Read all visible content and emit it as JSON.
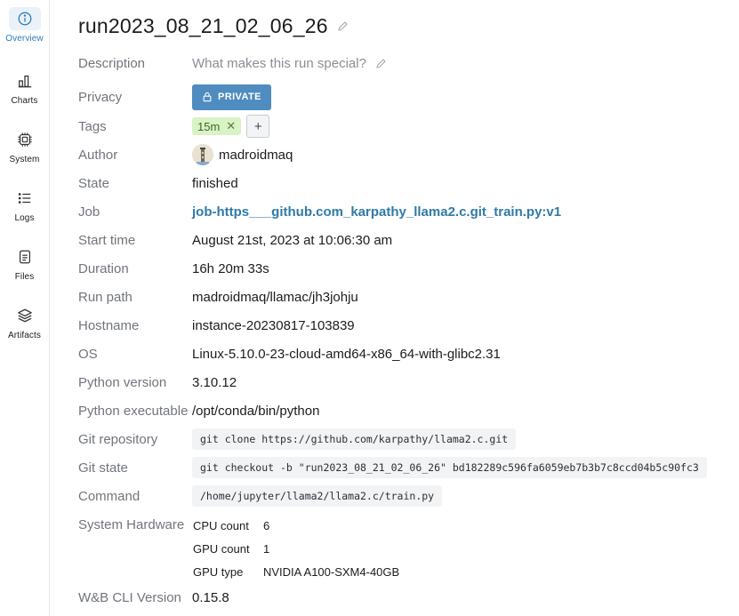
{
  "sidebar": {
    "items": [
      {
        "label": "Overview",
        "icon": "info-icon"
      },
      {
        "label": "Charts",
        "icon": "bar-chart-icon"
      },
      {
        "label": "System",
        "icon": "cpu-icon"
      },
      {
        "label": "Logs",
        "icon": "list-icon"
      },
      {
        "label": "Files",
        "icon": "file-icon"
      },
      {
        "label": "Artifacts",
        "icon": "layers-icon"
      }
    ],
    "active": "Overview",
    "active_color": "#2b7bb9"
  },
  "run": {
    "title": "run2023_08_21_02_06_26",
    "rows": {
      "description": {
        "label": "Description",
        "placeholder": "What makes this run special?"
      },
      "privacy": {
        "label": "Privacy",
        "value": "PRIVATE"
      },
      "tags": {
        "label": "Tags",
        "items": [
          "15m"
        ],
        "add": "+"
      },
      "author": {
        "label": "Author",
        "value": "madroidmaq"
      },
      "state": {
        "label": "State",
        "value": "finished"
      },
      "job": {
        "label": "Job",
        "value": "job-https___github.com_karpathy_llama2.c.git_train.py:v1"
      },
      "start_time": {
        "label": "Start time",
        "value": "August 21st, 2023 at 10:06:30 am"
      },
      "duration": {
        "label": "Duration",
        "value": "16h 20m 33s"
      },
      "run_path": {
        "label": "Run path",
        "value": "madroidmaq/llamac/jh3johju"
      },
      "hostname": {
        "label": "Hostname",
        "value": "instance-20230817-103839"
      },
      "os": {
        "label": "OS",
        "value": "Linux-5.10.0-23-cloud-amd64-x86_64-with-glibc2.31"
      },
      "python_version": {
        "label": "Python version",
        "value": "3.10.12"
      },
      "python_executable": {
        "label": "Python executable",
        "value": "/opt/conda/bin/python"
      },
      "git_repository": {
        "label": "Git repository",
        "value": "git clone https://github.com/karpathy/llama2.c.git"
      },
      "git_state": {
        "label": "Git state",
        "value": "git checkout -b \"run2023_08_21_02_06_26\" bd182289c596fa6059eb7b3b7c8ccd04b5c90fc3"
      },
      "command": {
        "label": "Command",
        "value": "/home/jupyter/llama2/llama2.c/train.py"
      },
      "system_hardware": {
        "label": "System Hardware",
        "items": [
          {
            "key": "CPU count",
            "value": "6"
          },
          {
            "key": "GPU count",
            "value": "1"
          },
          {
            "key": "GPU type",
            "value": "NVIDIA A100-SXM4-40GB"
          }
        ]
      },
      "wandb_cli": {
        "label": "W&B CLI Version",
        "value": "0.15.8"
      }
    }
  },
  "colors": {
    "privacy_button": "#4f8cc0",
    "tag_bg": "#d9f2c6",
    "link": "#2f7aa8"
  }
}
